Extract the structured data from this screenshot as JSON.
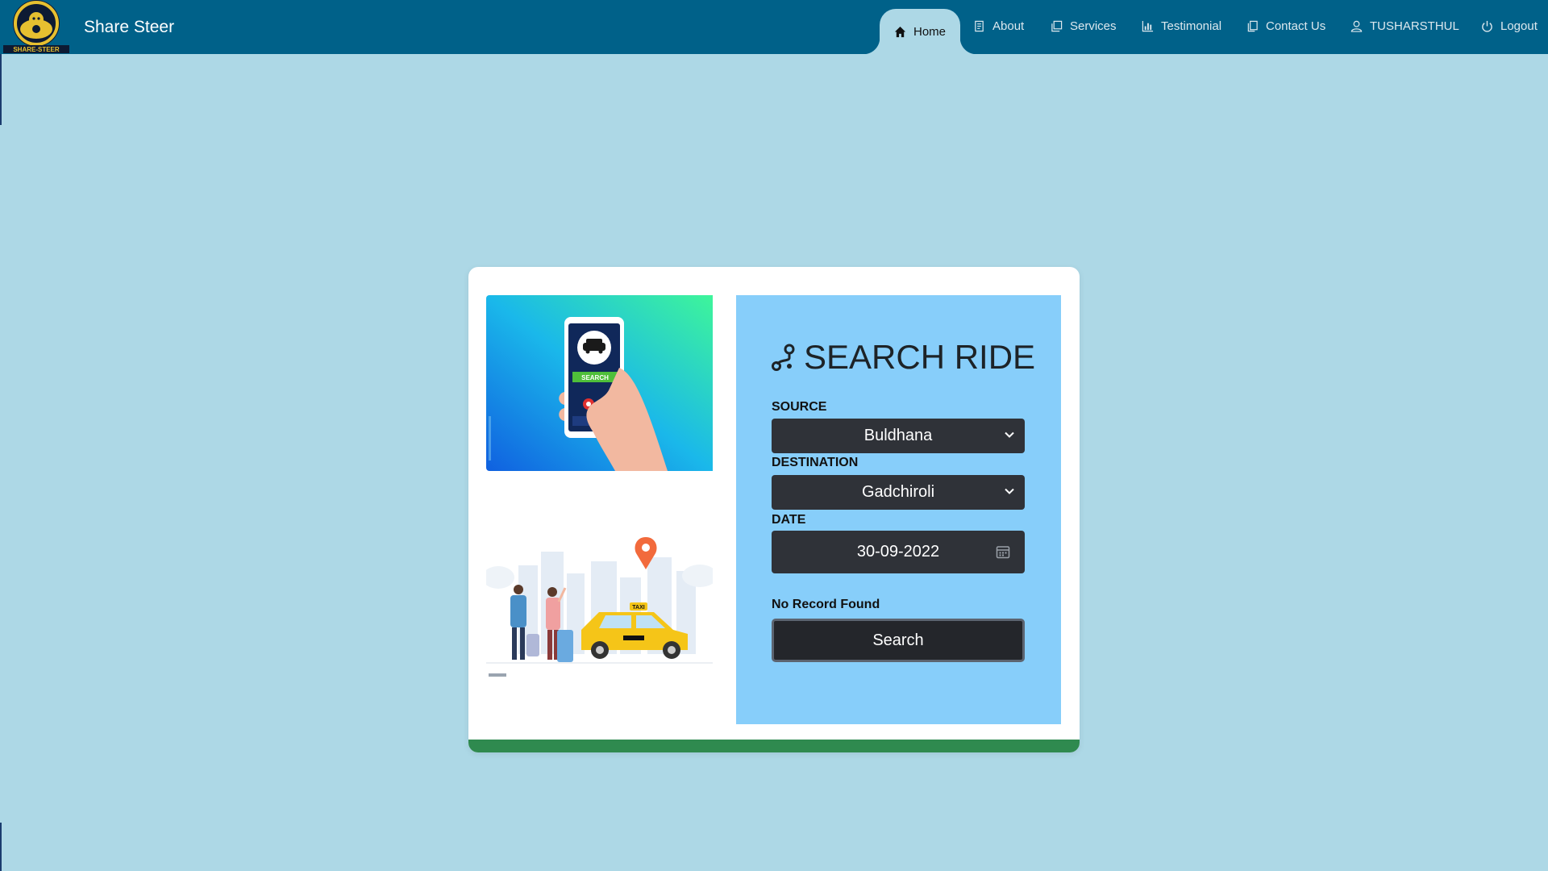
{
  "header": {
    "brand": "Share Steer",
    "logo_text": "SHARE-STEER",
    "nav": [
      {
        "label": "Home",
        "icon": "home-icon"
      },
      {
        "label": "About",
        "icon": "document-icon"
      },
      {
        "label": "Services",
        "icon": "copy-icon"
      },
      {
        "label": "Testimonial",
        "icon": "bar-chart-icon"
      },
      {
        "label": "Contact Us",
        "icon": "pages-icon"
      },
      {
        "label": "TUSHARSTHUL",
        "icon": "user-icon"
      },
      {
        "label": "Logout",
        "icon": "power-icon"
      }
    ]
  },
  "illustrations": {
    "phone_screen_text": "SEARCH",
    "taxi_sign": "TAXI"
  },
  "form": {
    "title": "SEARCH RIDE",
    "source_label": "SOURCE",
    "source_value": "Buldhana",
    "destination_label": "DESTINATION",
    "destination_value": "Gadchiroli",
    "date_label": "DATE",
    "date_value": "30-09-2022",
    "status": "No Record Found",
    "search_label": "Search"
  },
  "colors": {
    "navbar": "#006189",
    "background": "#add8e6",
    "panel": "#87cefa",
    "input": "#2f3238",
    "card_accent": "#2f8a4f"
  }
}
